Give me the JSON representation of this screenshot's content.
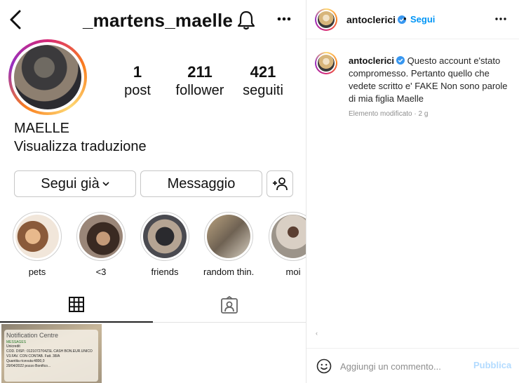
{
  "profile": {
    "username": "_martens_maelle",
    "name": "MAELLE",
    "translate_link": "Visualizza traduzione",
    "stats": {
      "posts_count": "1",
      "posts_label": "post",
      "followers_count": "211",
      "followers_label": "follower",
      "following_count": "421",
      "following_label": "seguiti"
    },
    "buttons": {
      "follow": "Segui già",
      "message": "Messaggio"
    },
    "highlights": [
      {
        "label": "pets"
      },
      {
        "label": "<3"
      },
      {
        "label": "friends"
      },
      {
        "label": "random thin..."
      },
      {
        "label": "moi"
      }
    ],
    "post_thumbnail": {
      "title": "Notification Centre",
      "app": "MESSAGES",
      "lines": [
        "Unicredit",
        "COD. DISP.: 0121072704ZSL CASH BON.EUR.UNICO",
        "V3.FAV. CON CONTAB. Fatt. 38/A",
        "Quantita ricevuta:4800,0",
        "29/04/2022 pozzo Bonifico..."
      ]
    }
  },
  "post": {
    "author": "antoclerici",
    "follow_label": "Segui",
    "separator": "•",
    "caption_user": "antoclerici",
    "caption_text": "Questo account e'stato compromesso. Pertanto quello che vedete scritto e' FAKE Non sono parole di mia figlia Maelle",
    "edited_label": "Elemento modificato · 2 g",
    "comment_placeholder": "Aggiungi un commento...",
    "publish_label": "Pubblica",
    "stray_mark": "‹"
  },
  "colors": {
    "link_blue": "#0095f6",
    "publish_disabled": "#b3dbff",
    "verified_blue": "#3897f0"
  }
}
